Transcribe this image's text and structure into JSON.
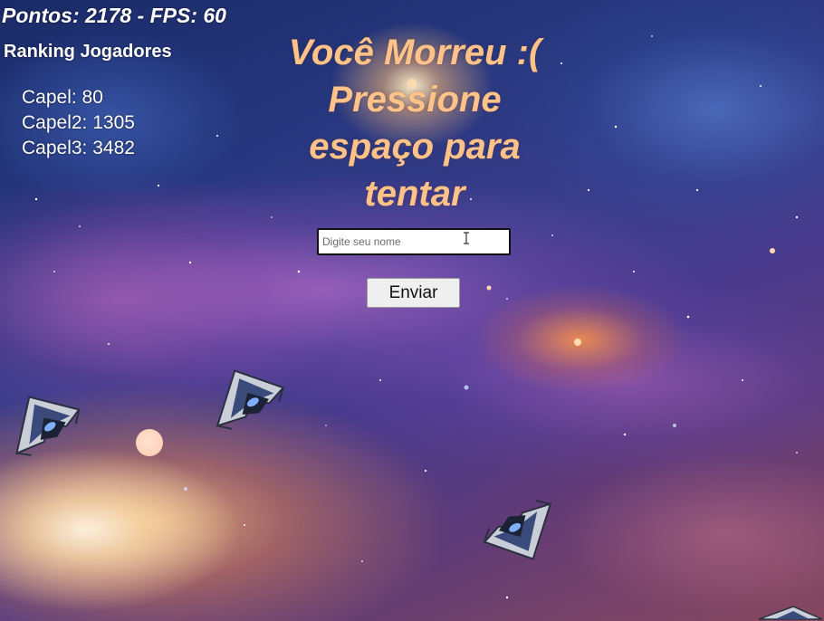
{
  "hud": {
    "score_text": "Pontos: 2178 - FPS: 60"
  },
  "ranking": {
    "title": "Ranking Jogadores",
    "entries": [
      {
        "text": "Capel: 80"
      },
      {
        "text": "Capel2: 1305"
      },
      {
        "text": "Capel3: 3482"
      }
    ]
  },
  "game_over": {
    "lines": [
      "Você Morreu :(",
      "Pressione",
      "espaço para",
      "tentar"
    ]
  },
  "name_form": {
    "placeholder": "Digite seu nome",
    "value": "",
    "submit_label": "Enviar"
  },
  "colors": {
    "message": "#ffc38a",
    "hud_text": "#ffffff"
  },
  "sprites": {
    "ship_icon": "spaceship-icon",
    "projectile": "energy-orb"
  }
}
